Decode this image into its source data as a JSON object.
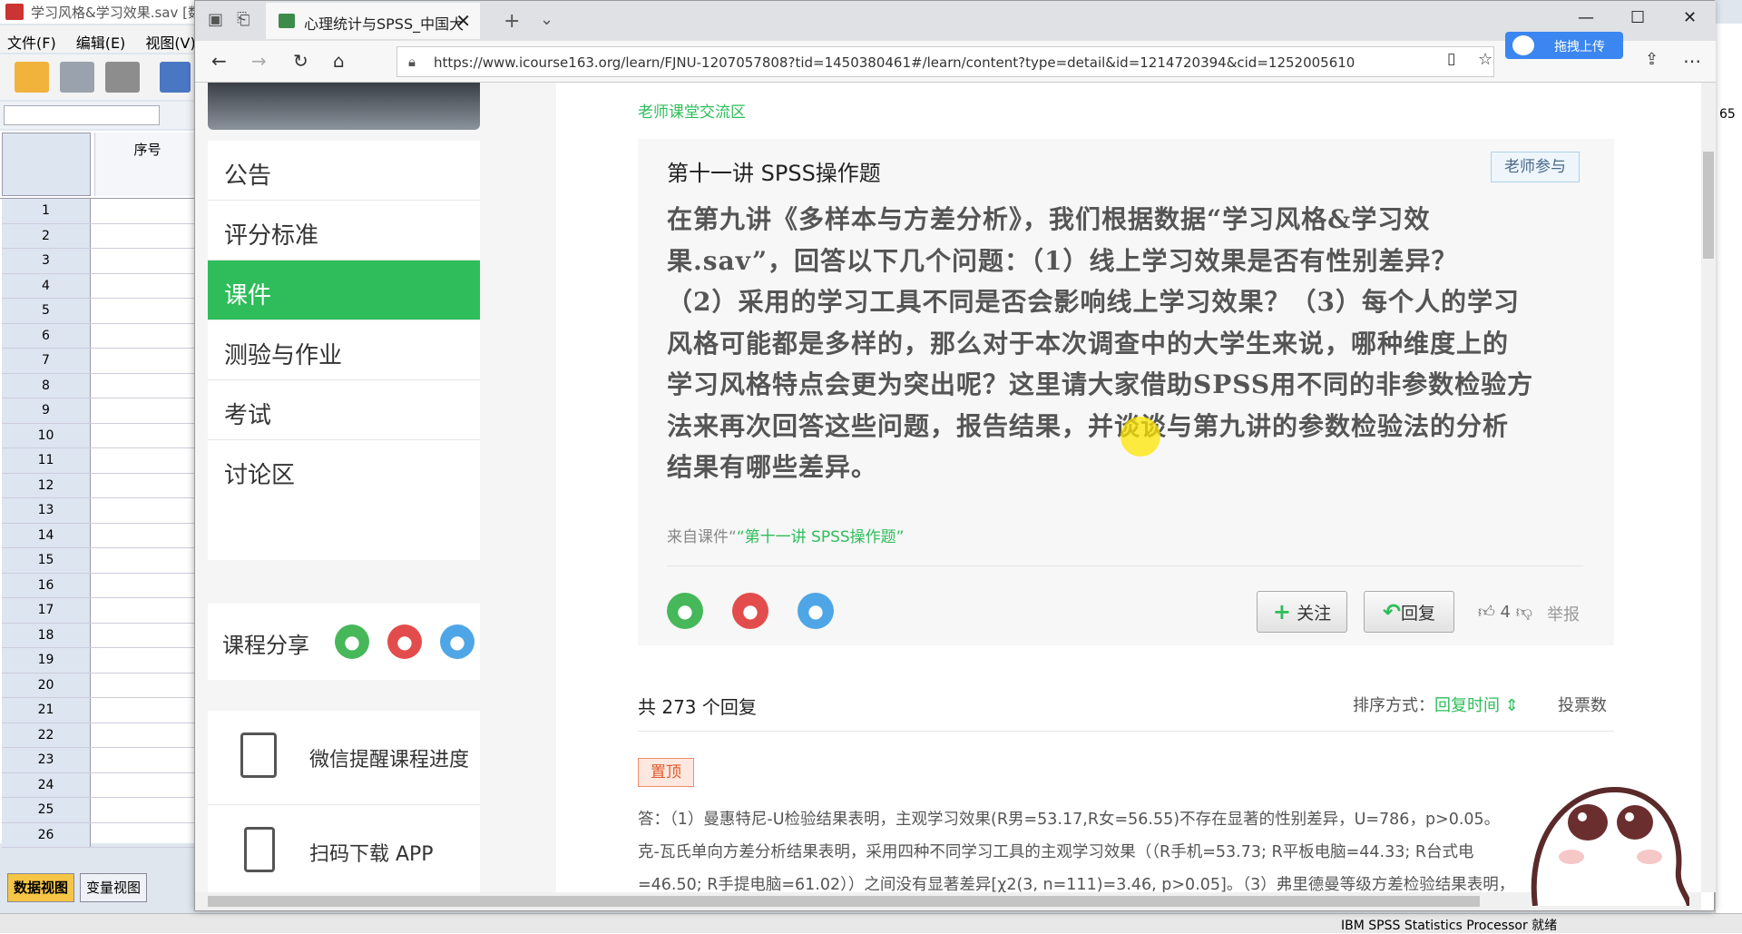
{
  "spss": {
    "title": "学习风格&学习效果.sav [数",
    "menu": [
      "文件(F)",
      "编辑(E)",
      "视图(V)"
    ],
    "column_header": "序号",
    "rows": [
      "1",
      "2",
      "3",
      "4",
      "5",
      "6",
      "7",
      "8",
      "9",
      "10",
      "11",
      "12",
      "13",
      "14",
      "15",
      "16",
      "17",
      "18",
      "19",
      "20",
      "21",
      "22",
      "23",
      "24",
      "25",
      "26"
    ],
    "tabs": {
      "data_view": "数据视图",
      "variable_view": "变量视图"
    },
    "status": "IBM SPSS Statistics Processor 就绪",
    "right_number": "65"
  },
  "browser": {
    "tab_title": "心理统计与SPSS_中国大",
    "url": "https://www.icourse163.org/learn/FJNU-1207057808?tid=1450380461#/learn/content?type=detail&id=1214720394&cid=1252005610",
    "upload_label": "拖拽上传"
  },
  "sidebar": {
    "menu": [
      {
        "label": "公告"
      },
      {
        "label": "评分标准"
      },
      {
        "label": "课件",
        "active": true
      },
      {
        "label": "测验与作业"
      },
      {
        "label": "考试"
      },
      {
        "label": "讨论区"
      }
    ],
    "share_label": "课程分享",
    "wechat_reminder": "微信提醒课程进度",
    "download_app": "扫码下载 APP"
  },
  "main": {
    "breadcrumb": "老师课堂交流区",
    "post": {
      "title": "第十一讲 SPSS操作题",
      "badge": "老师参与",
      "body_lines": [
        "在第九讲《多样本与方差分析》，我们根据数据“学习风格&学习效",
        "果.sav”，回答以下几个问题：（1）线上学习效果是否有性别差异？",
        "（2）采用的学习工具不同是否会影响线上学习效果？（3）每个人的学习",
        "风格可能都是多样的，那么对于本次调查中的大学生来说，哪种维度上的",
        "学习风格特点会更为突出呢？这里请大家借助SPSS用不同的非参数检验方",
        "法来再次回答这些问题，报告结果，并谈谈与第九讲的参数检验法的分析",
        "结果有哪些差异。"
      ],
      "source_prefix": "来自课件“",
      "source_link": "“第十一讲 SPSS操作题”",
      "follow_label": "关注",
      "reply_label": "回复",
      "likes": "4",
      "report_label": "举报"
    },
    "replies_count": "共 273 个回复",
    "sort_label": "排序方式：",
    "sort_value": "回复时间",
    "votes_label": "投票数",
    "pinned_label": "置顶",
    "answer_lines": [
      "答：（1）曼惠特尼-U检验结果表明，主观学习效果(R男=53.17,R女=56.55)不存在显著的性别差异，U=786，p>0.05。",
      "克-瓦氏单向方差分析结果表明，采用四种不同学习工具的主观学习效果（（R手机=53.73; R平板电脑=44.33; R台式电",
      "=46.50; R手提电脑=61.02））之间没有显著差异[χ2(3, n=111)=3.46, p>0.05]。（3）弗里德曼等级方差检验结果表明，"
    ]
  },
  "colors": {
    "accent": "#2ebd5a",
    "wechat": "#47b85a",
    "weibo": "#e34c4c",
    "qq": "#4fa6e6"
  }
}
